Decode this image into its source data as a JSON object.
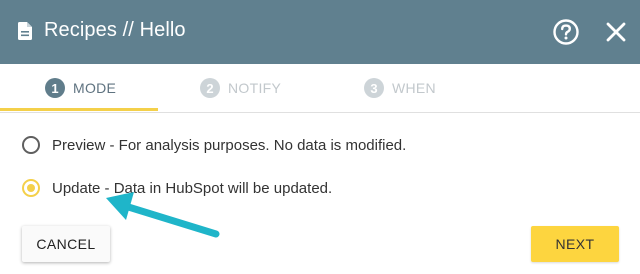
{
  "header": {
    "title": "Recipes // Hello",
    "bg_color": "#60808f",
    "icons": [
      "document-icon",
      "help-icon",
      "close-icon"
    ]
  },
  "tabs": [
    {
      "number": "1",
      "label": "MODE",
      "active": true
    },
    {
      "number": "2",
      "label": "NOTIFY",
      "active": false
    },
    {
      "number": "3",
      "label": "WHEN",
      "active": false
    }
  ],
  "options": [
    {
      "label": "Preview - For analysis purposes. No data is modified.",
      "selected": false
    },
    {
      "label": "Update - Data in HubSpot will be updated.",
      "selected": true
    }
  ],
  "buttons": {
    "cancel": "CANCEL",
    "next": "NEXT"
  },
  "colors": {
    "accent": "#f4d04a",
    "arrow": "#1fb5c9"
  }
}
